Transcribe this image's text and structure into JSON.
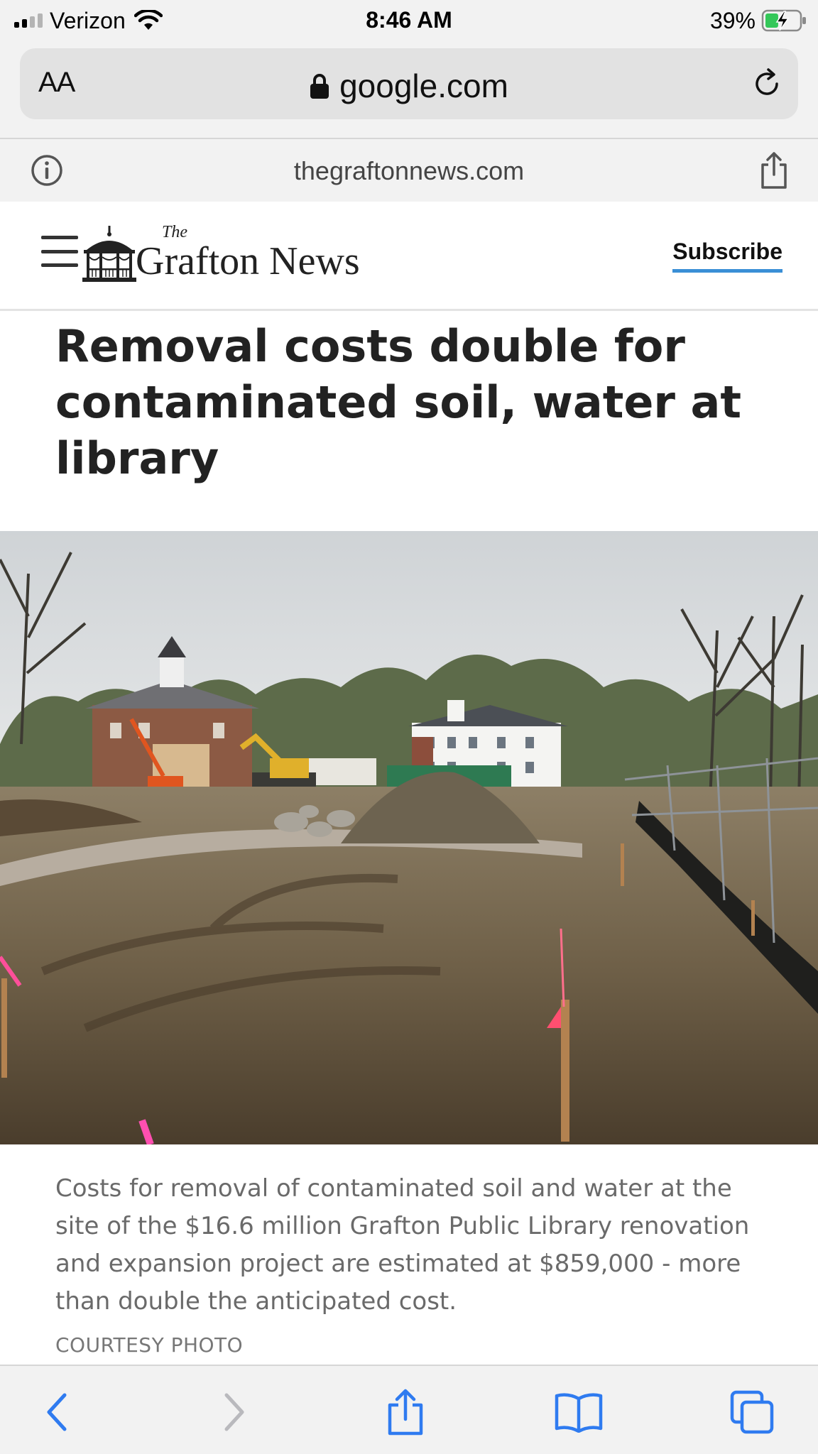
{
  "status_bar": {
    "carrier": "Verizon",
    "time": "8:46 AM",
    "battery": "39%",
    "battery_level": 0.39,
    "icons": [
      "signal-icon",
      "wifi-icon",
      "battery-charging-icon"
    ]
  },
  "address_bar": {
    "text_size_label": "AA",
    "url": "google.com",
    "icons": [
      "lock-icon",
      "reload-icon"
    ]
  },
  "amp_bar": {
    "domain": "thegraftonnews.com",
    "icons": [
      "info-icon",
      "share-icon"
    ]
  },
  "site_header": {
    "logo_the": "The",
    "logo_name": "Grafton News",
    "subscribe_label": "Subscribe",
    "accent_color": "#3a8fd6",
    "icons": [
      "hamburger-menu-icon",
      "gazebo-logo-icon"
    ]
  },
  "article": {
    "headline": "Removal costs double for contaminated soil, water at library",
    "caption": "Costs for removal of contaminated soil and water at the site of the $16.6 million Grafton Public Library renovation and expansion project are estimated at $859,000 - more than double the anticipated cost.",
    "photo_credit": "COURTESY PHOTO"
  },
  "toolbar": {
    "icons": [
      "back-icon",
      "forward-icon",
      "share-icon",
      "bookmarks-icon",
      "tabs-icon"
    ]
  }
}
